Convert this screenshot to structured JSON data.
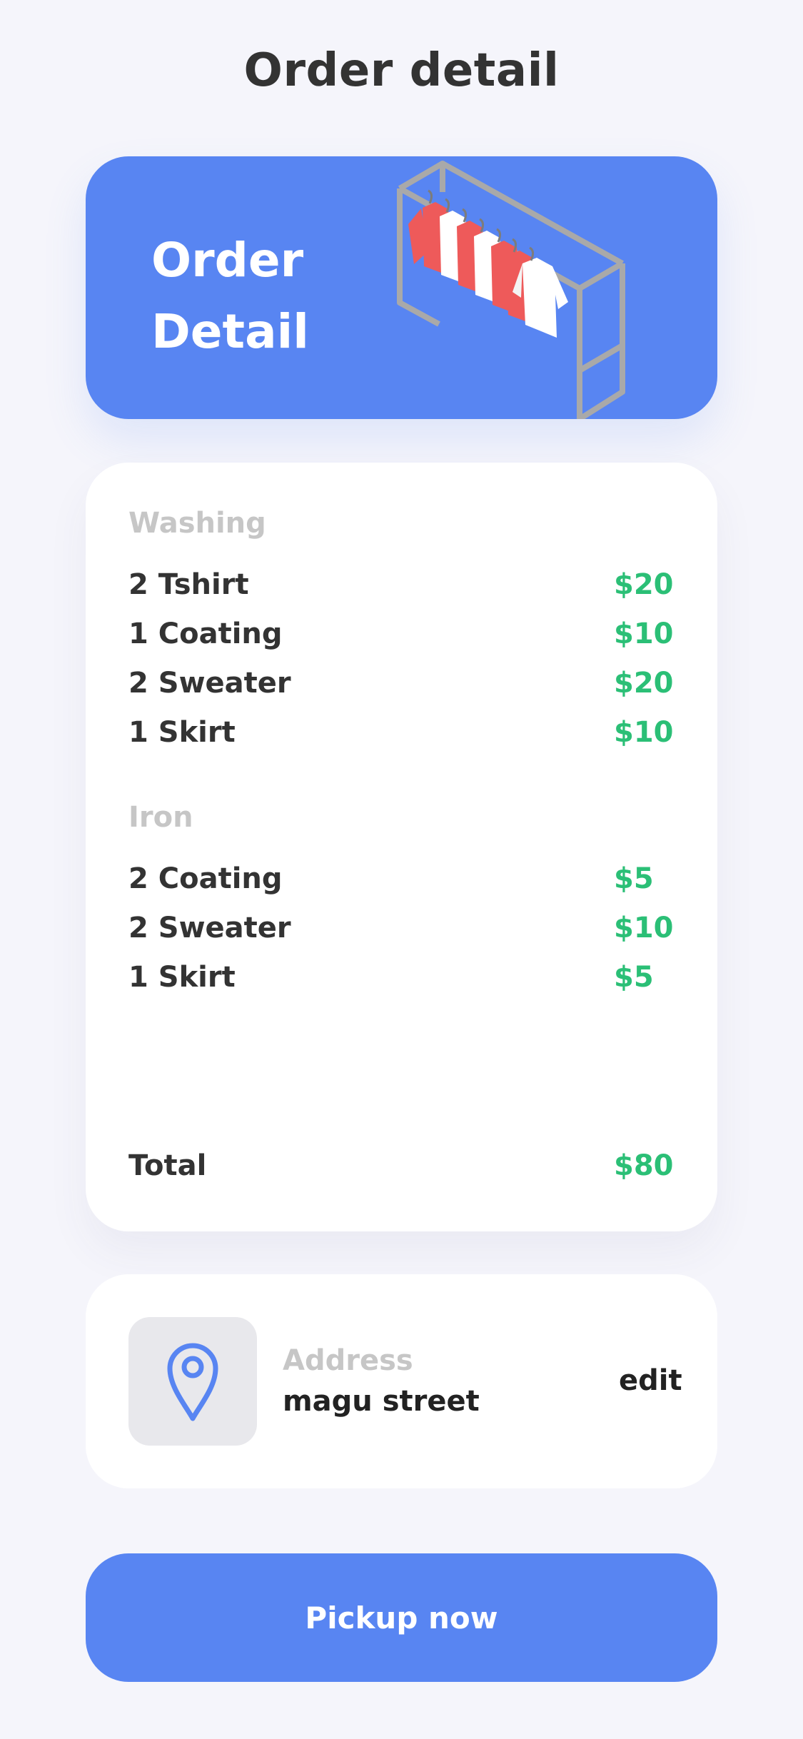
{
  "header": {
    "title": "Order detail"
  },
  "hero": {
    "title_line1": "Order",
    "title_line2": "Detail",
    "illustration": "clothes-rack-icon"
  },
  "order": {
    "sections": [
      {
        "label": "Washing",
        "items": [
          {
            "name": "2 Tshirt",
            "price": "$20"
          },
          {
            "name": "1 Coating",
            "price": "$10"
          },
          {
            "name": "2 Sweater",
            "price": "$20"
          },
          {
            "name": "1 Skirt",
            "price": "$10"
          }
        ]
      },
      {
        "label": "Iron",
        "items": [
          {
            "name": "2 Coating",
            "price": "$5"
          },
          {
            "name": "2 Sweater",
            "price": "$10"
          },
          {
            "name": "1 Skirt",
            "price": "$5"
          }
        ]
      }
    ],
    "total_label": "Total",
    "total_value": "$80"
  },
  "address": {
    "icon": "map-pin-icon",
    "label": "Address",
    "value": "magu street",
    "edit_label": "edit"
  },
  "action": {
    "pickup_label": "Pickup now"
  },
  "colors": {
    "background": "#f5f5fb",
    "brand_blue": "#5885f2",
    "price_green": "#2bbf76",
    "muted_label": "#c6c6c6",
    "rack_red": "#ee5a5a"
  }
}
